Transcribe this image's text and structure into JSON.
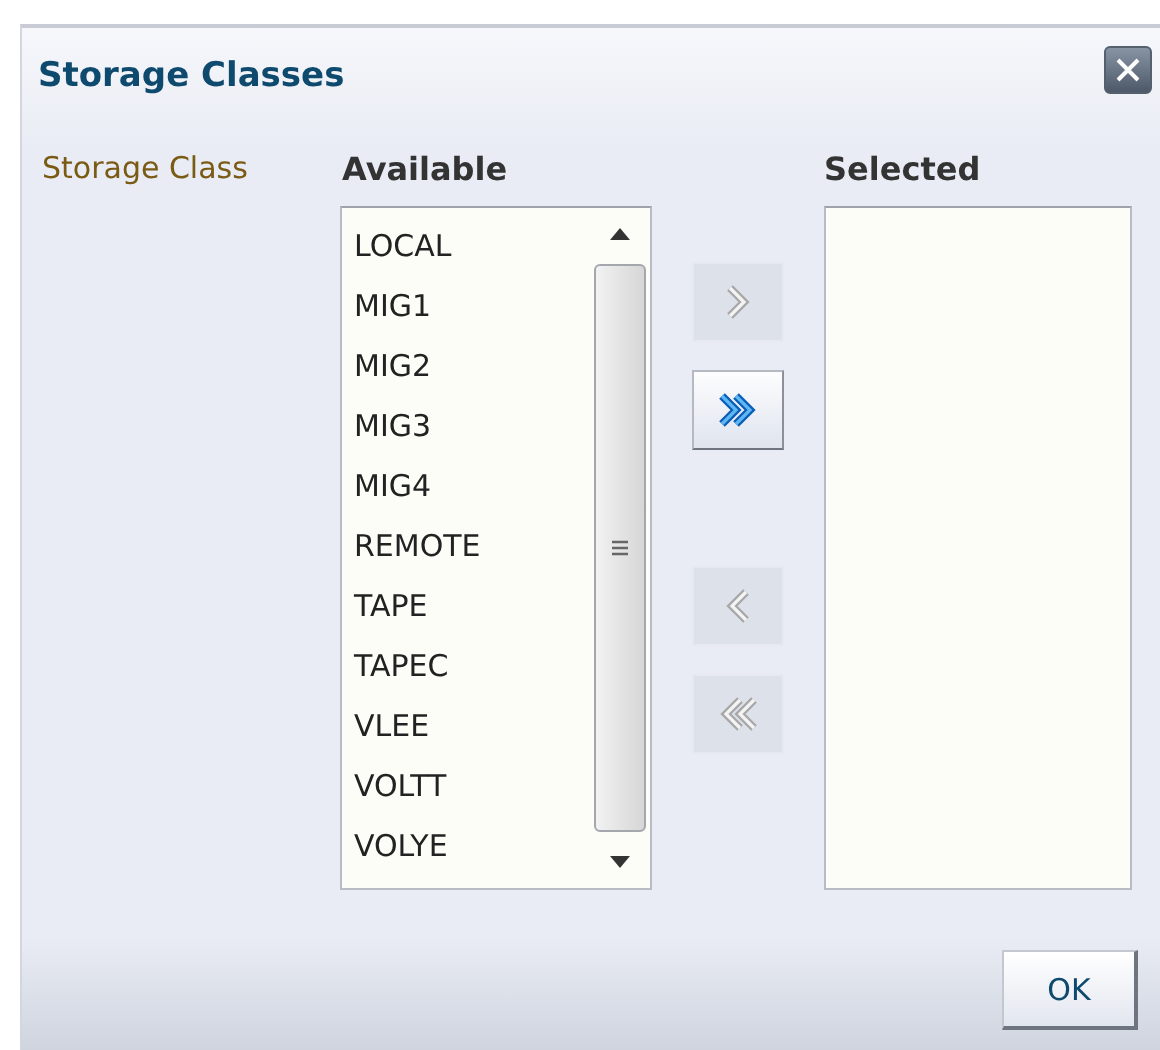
{
  "dialog": {
    "title": "Storage Classes"
  },
  "field": {
    "label": "Storage Class",
    "available_heading": "Available",
    "selected_heading": "Selected"
  },
  "available": [
    {
      "label": "LOCAL",
      "selected": false
    },
    {
      "label": "MIG1",
      "selected": false
    },
    {
      "label": "MIG2",
      "selected": false
    },
    {
      "label": "MIG3",
      "selected": false
    },
    {
      "label": "MIG4",
      "selected": false
    },
    {
      "label": "REMOTE",
      "selected": false
    },
    {
      "label": "TAPE",
      "selected": false
    },
    {
      "label": "TAPEC",
      "selected": false
    },
    {
      "label": "VLEE",
      "selected": false
    },
    {
      "label": "VOLTT",
      "selected": false
    },
    {
      "label": "VOLYE",
      "selected": false
    }
  ],
  "shuttle_buttons": [
    {
      "kind": "move",
      "disabled": true
    },
    {
      "kind": "move-all",
      "disabled": false
    },
    {
      "kind": "remove",
      "disabled": true
    },
    {
      "kind": "remove-all",
      "disabled": true
    }
  ],
  "buttons": [
    {
      "label": "OK"
    }
  ]
}
